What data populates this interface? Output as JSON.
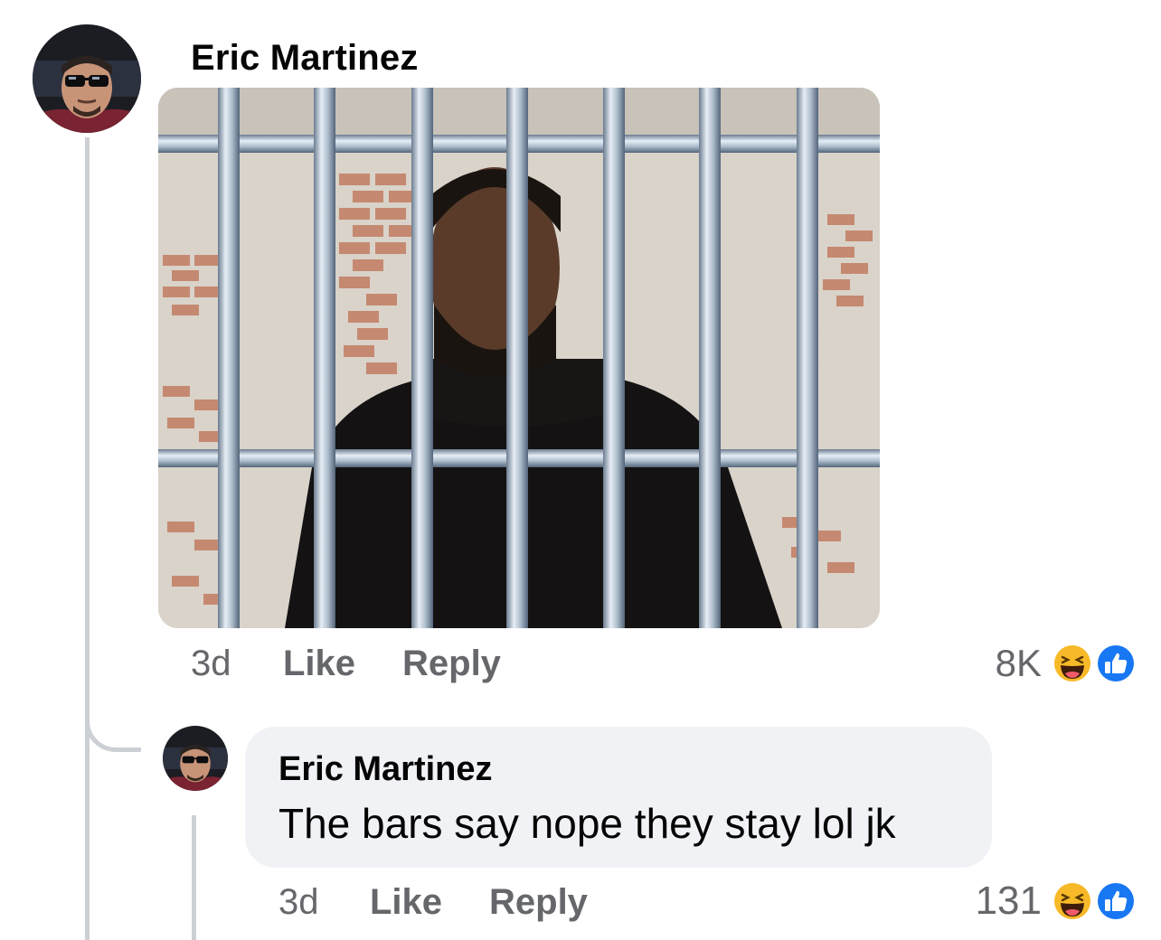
{
  "comment": {
    "author": "Eric Martinez",
    "time": "3d",
    "like_label": "Like",
    "reply_label": "Reply",
    "reaction_count": "8K",
    "reaction_icons": [
      "haha-icon",
      "like-icon"
    ]
  },
  "reply": {
    "author": "Eric Martinez",
    "text": "The bars say nope they stay lol jk",
    "time": "3d",
    "like_label": "Like",
    "reply_label": "Reply",
    "reaction_count": "131",
    "reaction_icons": [
      "haha-icon",
      "like-icon"
    ]
  },
  "colors": {
    "like_blue": "#1877f2",
    "haha_yellow": "#f7b928",
    "secondary_text": "#65676b",
    "bubble_bg": "#f0f2f5"
  }
}
